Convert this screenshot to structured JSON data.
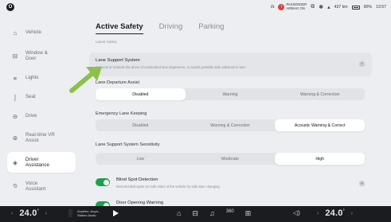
{
  "status": {
    "profile": "O",
    "airbag_line1": "PASSENGER",
    "airbag_line2": "AIRBAG ON",
    "range": "437 km",
    "battery": "90%",
    "time": "13:57"
  },
  "sidebar": {
    "items": [
      {
        "label": "Vehicle",
        "icon": "car-icon"
      },
      {
        "label": "Window & Door",
        "icon": "window-icon"
      },
      {
        "label": "Lights",
        "icon": "lights-icon"
      },
      {
        "label": "Seat",
        "icon": "seat-icon"
      },
      {
        "label": "Drive",
        "icon": "steering-icon"
      },
      {
        "label": "Real-time VR Assist",
        "icon": "vr-icon"
      },
      {
        "label": "Driver Assistance",
        "icon": "driver-assist-icon"
      },
      {
        "label": "Voice Assistant",
        "icon": "voice-icon"
      }
    ]
  },
  "tabs": [
    "Active Safety",
    "Driving",
    "Parking"
  ],
  "section_caption": "Latest Safety",
  "lane_support": {
    "title": "Lane Support System",
    "desc": "Corrects or reminds the driver of unintended lane departures, or avoids possible side collisions in lane"
  },
  "lane_departure": {
    "label": "Lane Departure Assist",
    "options": [
      "Disabled",
      "Warning",
      "Warning & Correction"
    ],
    "selected": 0
  },
  "emergency_lane": {
    "label": "Emergency Lane Keeping",
    "options": [
      "Disabled",
      "Warning & Correction",
      "Acoustic Warning & Correct"
    ],
    "selected": 2
  },
  "sensitivity": {
    "label": "Lane Support System Sensitivity",
    "options": [
      "Low",
      "Moderate",
      "High"
    ],
    "selected": 2
  },
  "blind_spot": {
    "title": "Blind Spot Detection",
    "desc": "Detects blind spots on both sides of the vehicle for safe lane changing"
  },
  "door_opening": {
    "title": "Door Opening Warning"
  },
  "bottom": {
    "temp_left": "24.0",
    "temp_right": "24.0",
    "unit": "°",
    "media_title": "Anytime, Anyw...",
    "media_sub": "Station Audio",
    "dock_number": "360"
  },
  "colors": {
    "toggle_on": "#18a34a",
    "arrow": "#8cc04a"
  }
}
